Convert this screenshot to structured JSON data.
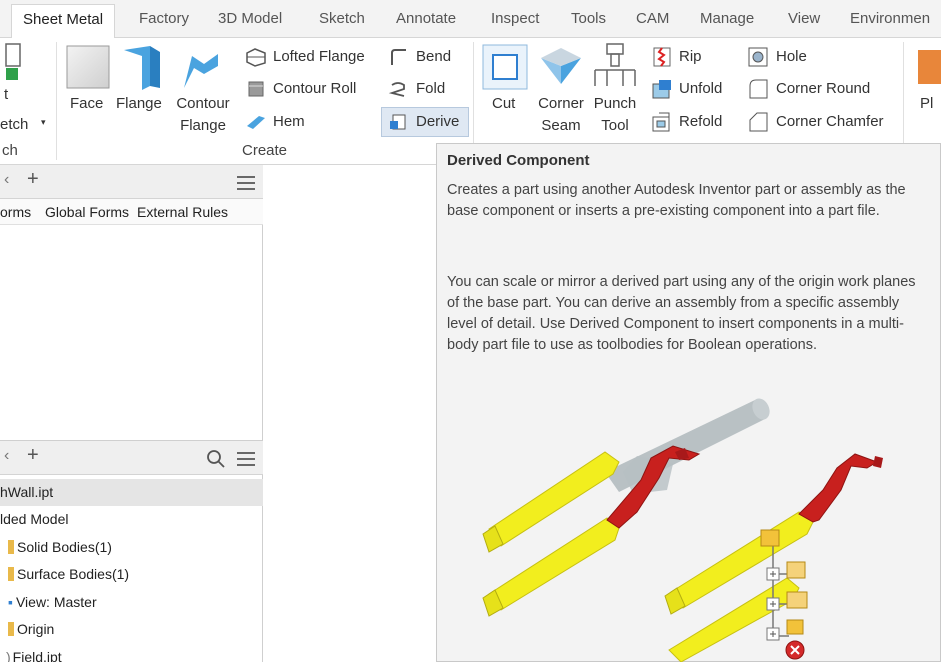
{
  "tabs": [
    {
      "label": "Sheet Metal",
      "active": true
    },
    {
      "label": "Factory"
    },
    {
      "label": "3D Model"
    },
    {
      "label": "Sketch"
    },
    {
      "label": "Annotate"
    },
    {
      "label": "Inspect"
    },
    {
      "label": "Tools"
    },
    {
      "label": "CAM"
    },
    {
      "label": "Manage"
    },
    {
      "label": "View"
    },
    {
      "label": "Environmen"
    }
  ],
  "ribbon": {
    "sketch": {
      "line1": "t",
      "line2": "etch",
      "panel": "ch"
    },
    "face": "Face",
    "flange": "Flange",
    "contour_flange": {
      "line1": "Contour",
      "line2": "Flange"
    },
    "lofted_flange": "Lofted Flange",
    "contour_roll": "Contour Roll",
    "hem": "Hem",
    "bend": "Bend",
    "fold": "Fold",
    "derive": "Derive",
    "create_panel": "Create",
    "cut": "Cut",
    "corner_seam": {
      "line1": "Corner",
      "line2": "Seam"
    },
    "punch_tool": {
      "line1": "Punch",
      "line2": "Tool"
    },
    "rip": "Rip",
    "unfold": "Unfold",
    "refold": "Refold",
    "hole": "Hole",
    "corner_round": "Corner Round",
    "corner_chamfer": "Corner Chamfer",
    "pl": "Pl"
  },
  "ilogic_pane": {
    "tabs": [
      "orms",
      "Global Forms",
      "External Rules"
    ]
  },
  "model_pane": {
    "rows": [
      {
        "label": "hWall.ipt",
        "selected": true
      },
      {
        "label": "lded Model"
      },
      {
        "label": "Solid Bodies(1)",
        "folder": true
      },
      {
        "label": "Surface Bodies(1)",
        "folder": true
      },
      {
        "label": "View: Master",
        "bullet": true
      },
      {
        "label": "Origin",
        "folder": true
      },
      {
        "label": "Field.ipt",
        "bullet": true
      }
    ]
  },
  "tooltip": {
    "title": "Derived Component",
    "para1": "Creates a part using another Autodesk Inventor part or assembly as the base component or inserts a pre-existing component into a part file.",
    "para2": "You can scale or mirror a derived part using any of the origin work planes of the base part. You can derive an assembly from a specific assembly level of detail. Use Derived Component to insert components in a multi-body part file to use as toolbodies for Boolean operations."
  },
  "colors": {
    "yellow_part": "#f2ee1e",
    "red_part": "#c8201e",
    "grey_part": "#aeb7bb",
    "accent_blue": "#2f7fd0"
  }
}
